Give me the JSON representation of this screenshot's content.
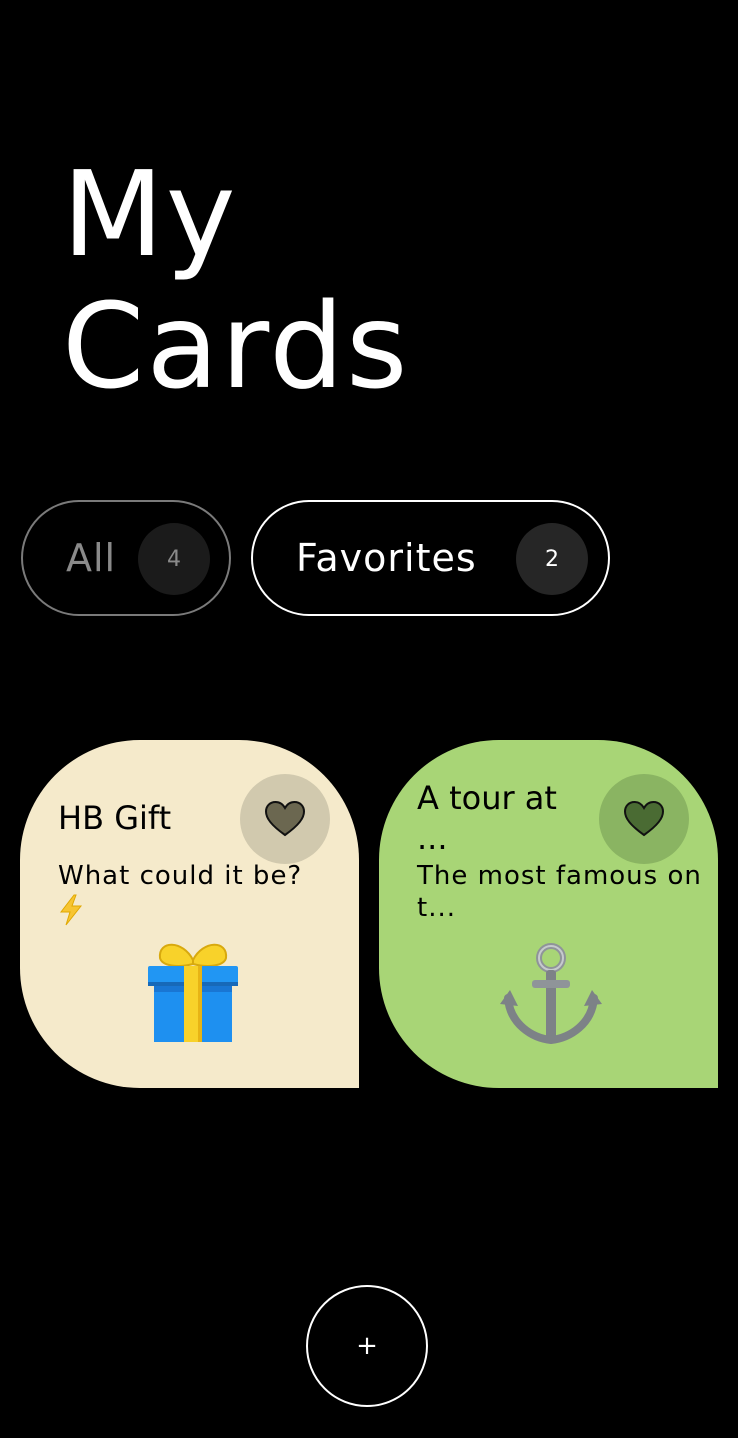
{
  "header": {
    "title_line1": "My",
    "title_line2": "Cards"
  },
  "filters": {
    "all": {
      "label": "All",
      "count": "4"
    },
    "favorites": {
      "label": "Favorites",
      "count": "2"
    }
  },
  "cards": [
    {
      "title": "HB Gift",
      "description": "What could it be?",
      "description_emoji": "⚡",
      "icon": "gift-icon",
      "favorite_icon": "heart-icon",
      "color": "#f5eacb"
    },
    {
      "title": "A tour at ...",
      "description": "The most famous on t...",
      "icon": "anchor-icon",
      "favorite_icon": "heart-icon",
      "color": "#a8d576"
    }
  ],
  "add_button": {
    "label": "+"
  },
  "colors": {
    "background": "#000000",
    "card_1": "#f5eacb",
    "card_2": "#a8d576"
  }
}
